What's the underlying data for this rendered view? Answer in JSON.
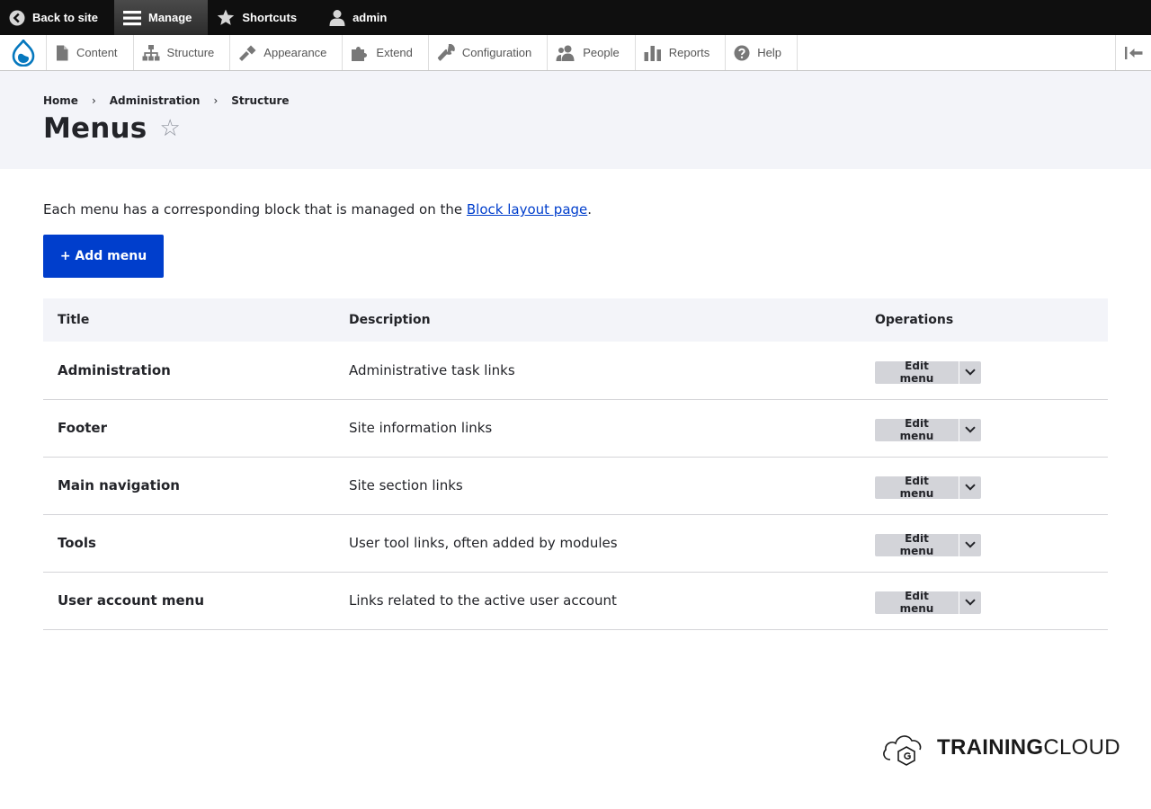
{
  "toolbar": {
    "back_to_site": "Back to site",
    "manage": "Manage",
    "shortcuts": "Shortcuts",
    "user": "admin"
  },
  "tray": {
    "items": [
      {
        "label": "Content",
        "icon": "file-icon"
      },
      {
        "label": "Structure",
        "icon": "sitemap-icon"
      },
      {
        "label": "Appearance",
        "icon": "paintbrush-icon"
      },
      {
        "label": "Extend",
        "icon": "puzzle-icon"
      },
      {
        "label": "Configuration",
        "icon": "wrench-icon"
      },
      {
        "label": "People",
        "icon": "people-icon"
      },
      {
        "label": "Reports",
        "icon": "bar-chart-icon"
      },
      {
        "label": "Help",
        "icon": "help-icon"
      }
    ]
  },
  "breadcrumb": [
    "Home",
    "Administration",
    "Structure"
  ],
  "page": {
    "title": "Menus",
    "intro_text": "Each menu has a corresponding block that is managed on the ",
    "intro_link": "Block layout page",
    "intro_end": ".",
    "add_button": "+ Add menu"
  },
  "table": {
    "headers": [
      "Title",
      "Description",
      "Operations"
    ],
    "rows": [
      {
        "title": "Administration",
        "description": "Administrative task links",
        "operation": "Edit menu"
      },
      {
        "title": "Footer",
        "description": "Site information links",
        "operation": "Edit menu"
      },
      {
        "title": "Main navigation",
        "description": "Site section links",
        "operation": "Edit menu"
      },
      {
        "title": "Tools",
        "description": "User tool links, often added by modules",
        "operation": "Edit menu"
      },
      {
        "title": "User account menu",
        "description": "Links related to the active user account",
        "operation": "Edit menu"
      }
    ]
  },
  "footer": {
    "brand_bold": "TRAINING",
    "brand_regular": "CLOUD"
  },
  "colors": {
    "primary": "#003ecc",
    "toolbar_bg": "#0f0f0f",
    "header_bg": "#f3f4f9"
  }
}
